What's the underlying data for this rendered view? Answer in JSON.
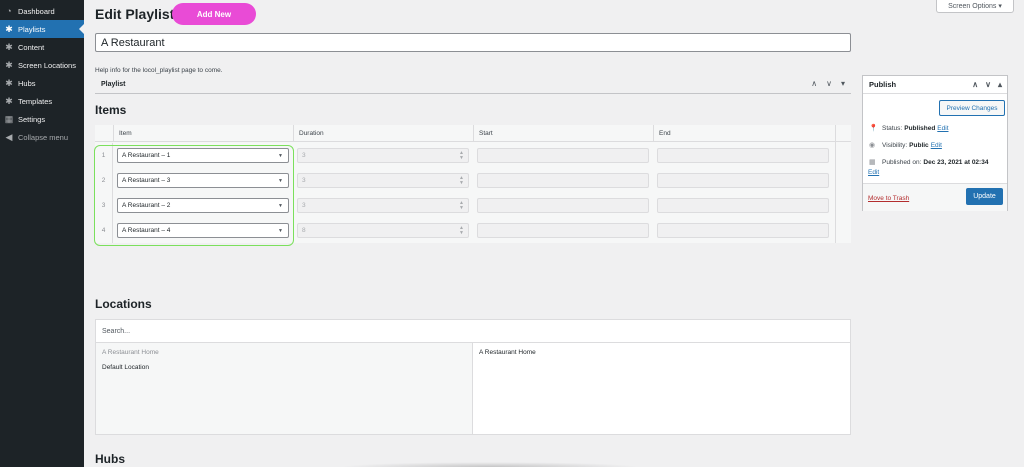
{
  "sidebar": {
    "items": [
      {
        "label": "Dashboard",
        "icon": "dashboard-icon",
        "glyph": "◔"
      },
      {
        "label": "Playlists",
        "icon": "gear-icon",
        "glyph": "✱"
      },
      {
        "label": "Content",
        "icon": "gear-icon",
        "glyph": "✱"
      },
      {
        "label": "Screen Locations",
        "icon": "gear-icon",
        "glyph": "✱"
      },
      {
        "label": "Hubs",
        "icon": "gear-icon",
        "glyph": "✱"
      },
      {
        "label": "Templates",
        "icon": "gear-icon",
        "glyph": "✱"
      },
      {
        "label": "Settings",
        "icon": "settings-icon",
        "glyph": "▦"
      },
      {
        "label": "Collapse menu",
        "icon": "collapse-icon",
        "glyph": "◀"
      }
    ],
    "active_index": 1
  },
  "screen_options": "Screen Options ▾",
  "header": {
    "title": "Edit Playlist",
    "add_new": "Add New"
  },
  "post_title": "A Restaurant",
  "help_text": "Help info for the locol_playlist page to come.",
  "playlist_box": {
    "label": "Playlist",
    "ctrl_up": "∧",
    "ctrl_down": "∨",
    "ctrl_toggle": "▾"
  },
  "items": {
    "heading": "Items",
    "columns": [
      "Item",
      "Duration",
      "Start",
      "End"
    ],
    "rows": [
      {
        "num": "1",
        "item": "A Restaurant – 1",
        "duration": "3"
      },
      {
        "num": "2",
        "item": "A Restaurant – 3",
        "duration": "3"
      },
      {
        "num": "3",
        "item": "A Restaurant – 2",
        "duration": "3"
      },
      {
        "num": "4",
        "item": "A Restaurant – 4",
        "duration": "8"
      }
    ]
  },
  "locations": {
    "heading": "Locations",
    "search_placeholder": "Search...",
    "available": [
      "A Restaurant Home",
      "Default Location"
    ],
    "selected": [
      "A Restaurant Home"
    ]
  },
  "hubs": {
    "heading": "Hubs"
  },
  "publish": {
    "title": "Publish",
    "ctrl_up": "∧",
    "ctrl_down": "∨",
    "ctrl_toggle": "▴",
    "preview": "Preview Changes",
    "status_label": "Status:",
    "status_value": "Published",
    "visibility_label": "Visibility:",
    "visibility_value": "Public",
    "published_label": "Published on:",
    "published_value": "Dec 23, 2021 at 02:34",
    "edit": "Edit",
    "trash": "Move to Trash",
    "update": "Update"
  },
  "colors": {
    "accent": "#2271b1",
    "add_new": "#e94bd6",
    "highlight": "#7be05c",
    "sidebar": "#1d2327"
  }
}
